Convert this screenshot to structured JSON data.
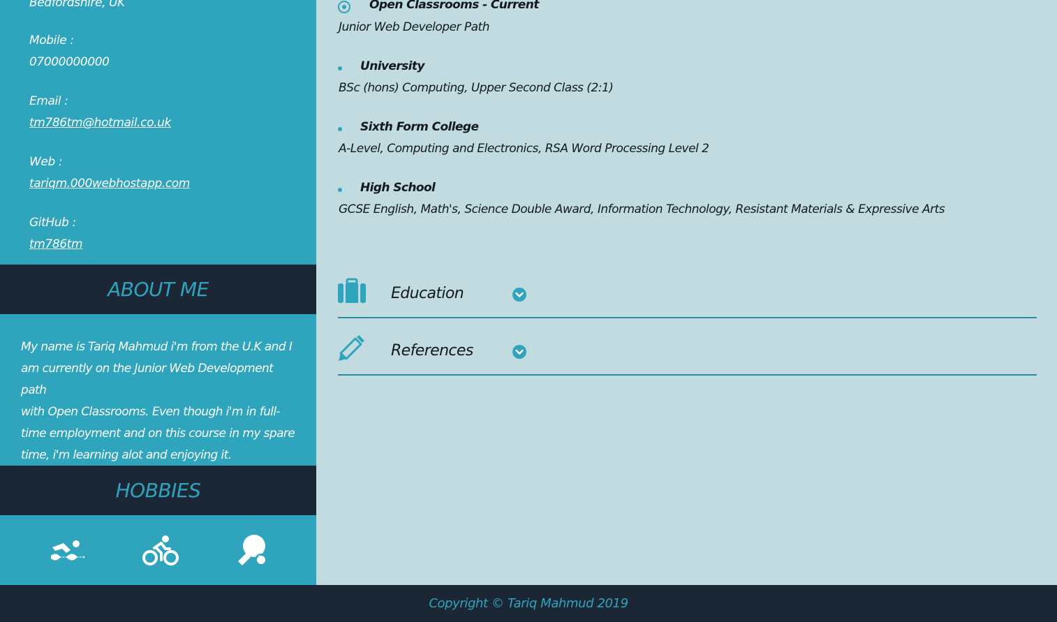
{
  "contact": {
    "location": "Bedfordshire, UK",
    "mobile_label": "Mobile :",
    "mobile_value": "07000000000",
    "email_label": "Email :",
    "email_value": "tm786tm@hotmail.co.uk",
    "web_label": "Web :",
    "web_value": "tariqm.000webhostapp.com",
    "github_label": "GitHub :",
    "github_value": "tm786tm"
  },
  "about": {
    "heading": "ABOUT ME",
    "lines": [
      "My name is Tariq Mahmud i'm from the U.K and I",
      "am currently on the Junior Web Development path",
      "with Open Classrooms. Even though i'm in full-",
      "time employment and on this course in my spare",
      "time, i'm learning alot and enjoying it."
    ]
  },
  "hobbies": {
    "heading": "HOBBIES",
    "icons": [
      "swimmer-icon",
      "biking-icon",
      "table-tennis-icon"
    ]
  },
  "education": [
    {
      "title": "Open Classrooms - Current",
      "desc": "Junior Web Developer Path"
    },
    {
      "title": "University",
      "desc": "BSc (hons) Computing, Upper Second Class (2:1)"
    },
    {
      "title": "Sixth Form College",
      "desc": "A-Level, Computing and Electronics, RSA Word Processing Level 2"
    },
    {
      "title": "High School",
      "desc": "GCSE English, Math's, Science Double Award, Information Technology, Resistant Materials & Expressive Arts"
    }
  ],
  "accordions": [
    {
      "label": "Education",
      "icon": "briefcase-icon"
    },
    {
      "label": "References",
      "icon": "pencil-icon"
    }
  ],
  "footer": {
    "copyright": "Copyright © Tariq Mahmud 2019"
  },
  "colors": {
    "sidebar": "#2ea4bd",
    "dark": "#1c2736",
    "main_bg": "#c1dbe0",
    "accent": "#2ea4bd"
  }
}
